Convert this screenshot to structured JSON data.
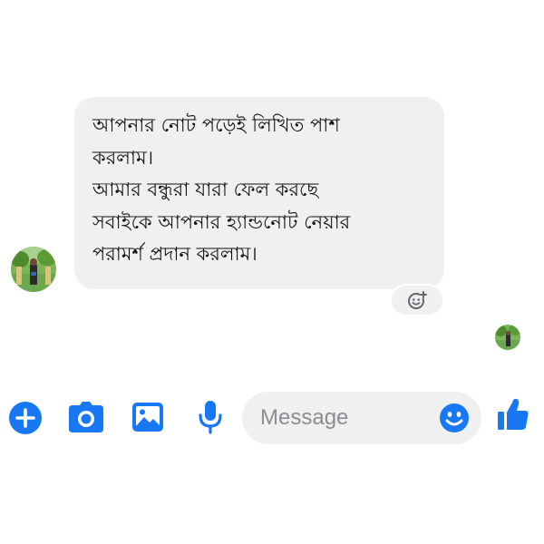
{
  "conversation": {
    "message": {
      "lines": [
        "আপনার নোট পড়েই লিখিত পাশ",
        "করলাম।",
        "আমার বন্ধুরা যারা ফেল করছে",
        "সবাইকে আপনার হ্যান্ডনোট নেয়ার",
        "পরামর্শ প্রদান করলাম।"
      ]
    },
    "react_icon": "add-reaction-icon",
    "seen_avatar_icon": "seen-avatar"
  },
  "composer": {
    "placeholder": "Message",
    "icons": [
      "plus-icon",
      "camera-icon",
      "image-icon",
      "microphone-icon",
      "emoji-icon",
      "thumbs-up-icon"
    ]
  },
  "colors": {
    "accent": "#1877f2",
    "bubble": "#f1f0f0",
    "text": "#111111",
    "placeholder": "#8a8d91"
  }
}
